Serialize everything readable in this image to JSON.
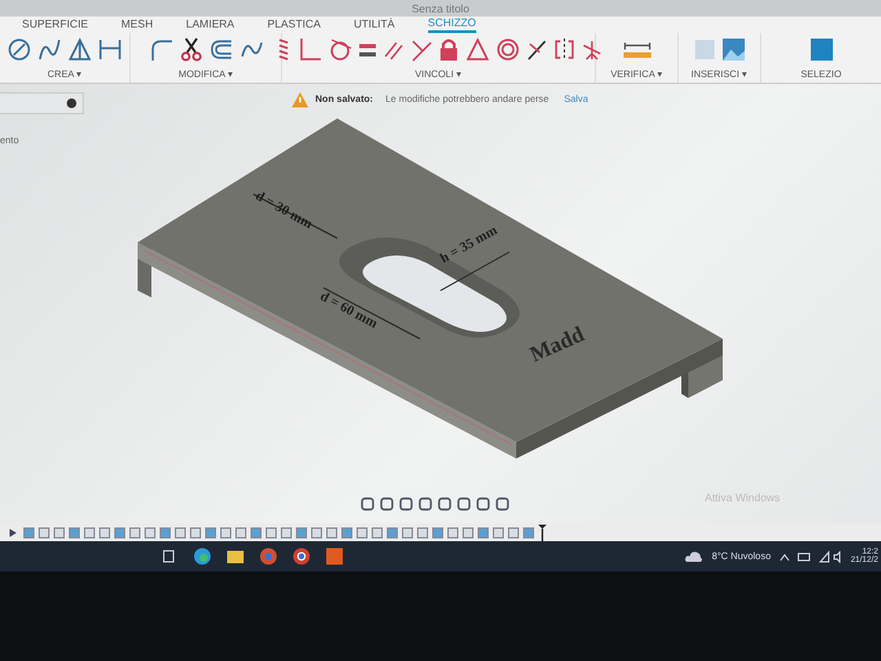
{
  "window": {
    "title": "Senza titolo"
  },
  "tabs": [
    {
      "label": "SUPERFICIE",
      "selected": false
    },
    {
      "label": "MESH",
      "selected": false
    },
    {
      "label": "LAMIERA",
      "selected": false
    },
    {
      "label": "PLASTICA",
      "selected": false
    },
    {
      "label": "UTILITÀ",
      "selected": false
    },
    {
      "label": "SCHIZZO",
      "selected": true
    }
  ],
  "toolbar_groups": [
    {
      "label": "CREA ▾"
    },
    {
      "label": "MODIFICA ▾"
    },
    {
      "label": "VINCOLI ▾"
    },
    {
      "label": "VERIFICA ▾"
    },
    {
      "label": "INSERISCI ▾"
    },
    {
      "label": "SELEZIO"
    }
  ],
  "browser_panel": {
    "item": "ento"
  },
  "notification": {
    "title": "Non salvato:",
    "message": "Le modifiche potrebbero andare perse",
    "action": "Salva"
  },
  "model_annotations": [
    {
      "text": "d = 30 mm"
    },
    {
      "text": "h = 35 mm"
    },
    {
      "text": "d = 60 mm"
    },
    {
      "text": "Madd"
    }
  ],
  "activation_notice": {
    "title": "Attiva Windows"
  },
  "taskbar": {
    "weather": "8°C Nuvoloso",
    "time": "12:2",
    "date": "21/12/2"
  }
}
